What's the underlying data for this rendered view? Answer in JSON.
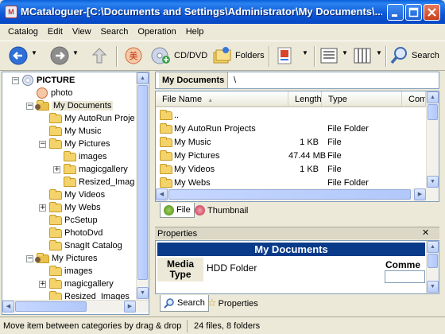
{
  "window": {
    "title": "MCataloguer-[C:\\Documents and Settings\\Administrator\\My Documents\\..."
  },
  "menu": [
    "Catalog",
    "Edit",
    "View",
    "Search",
    "Operation",
    "Help"
  ],
  "toolbar": {
    "cd_label": "CD/DVD",
    "folders_label": "Folders",
    "search_label": "Search"
  },
  "tree": {
    "items": [
      {
        "label": "PICTURE",
        "icon": "cd-disc-icon",
        "expander": "−"
      },
      {
        "label": "photo",
        "icon": "photo-icon",
        "expander": ""
      },
      {
        "label": "My Documents",
        "icon": "user-folder-icon",
        "expander": "−"
      },
      {
        "label": "My AutoRun Proje",
        "icon": "folder-icon",
        "expander": ""
      },
      {
        "label": "My Music",
        "icon": "folder-icon",
        "expander": ""
      },
      {
        "label": "My Pictures",
        "icon": "folder-icon",
        "expander": "−"
      },
      {
        "label": "images",
        "icon": "folder-icon",
        "expander": ""
      },
      {
        "label": "magicgallery",
        "icon": "folder-icon",
        "expander": "+"
      },
      {
        "label": "Resized_Imag",
        "icon": "folder-icon",
        "expander": ""
      },
      {
        "label": "My Videos",
        "icon": "folder-icon",
        "expander": ""
      },
      {
        "label": "My Webs",
        "icon": "folder-icon",
        "expander": "+"
      },
      {
        "label": "PcSetup",
        "icon": "folder-icon",
        "expander": ""
      },
      {
        "label": "PhotoDvd",
        "icon": "folder-icon",
        "expander": ""
      },
      {
        "label": "SnagIt Catalog",
        "icon": "folder-icon",
        "expander": ""
      },
      {
        "label": "My Pictures",
        "icon": "user-folder-icon",
        "expander": "−"
      },
      {
        "label": "images",
        "icon": "folder-icon",
        "expander": ""
      },
      {
        "label": "magicgallery",
        "icon": "folder-icon",
        "expander": "+"
      },
      {
        "label": "Resized_Images",
        "icon": "folder-icon",
        "expander": ""
      }
    ]
  },
  "path": {
    "current": "My Documents",
    "separator": "\\"
  },
  "files": {
    "columns": [
      "File Name",
      "Length",
      "Type",
      "Com"
    ],
    "rows": [
      {
        "name": "..",
        "length": "",
        "type": ""
      },
      {
        "name": "My AutoRun Projects",
        "length": "",
        "type": "File Folder"
      },
      {
        "name": "My Music",
        "length": "1 KB",
        "type": "File"
      },
      {
        "name": "My Pictures",
        "length": "47.44 MB",
        "type": "File"
      },
      {
        "name": "My Videos",
        "length": "1 KB",
        "type": "File"
      },
      {
        "name": "My Webs",
        "length": "",
        "type": "File Folder"
      }
    ]
  },
  "file_tabs": [
    "File",
    "Thumbnail"
  ],
  "properties": {
    "header": "Properties",
    "title": "My Documents",
    "media_type_label": "Media Type",
    "media_type_value": "HDD Folder",
    "comment_label": "Comme"
  },
  "bottom_tabs": [
    "Search",
    "Properties"
  ],
  "status": {
    "hint": "Move item between categories by drag & drop",
    "summary": "24 files, 8 folders"
  }
}
